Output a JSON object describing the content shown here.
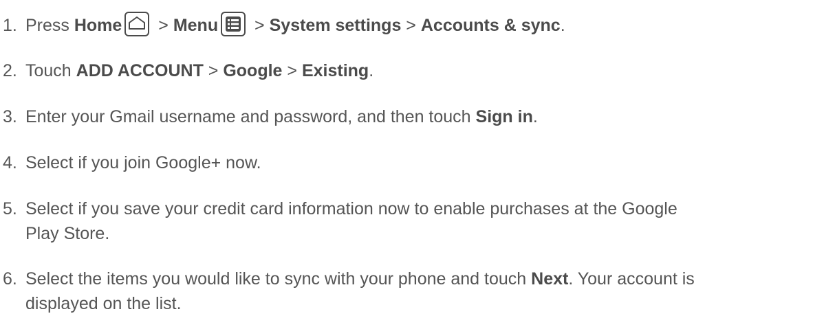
{
  "steps": [
    {
      "num": "1.",
      "parts": {
        "press": "Press ",
        "home": "Home",
        "sep1": " > ",
        "menu": "Menu",
        "sep2": " > ",
        "system_settings": "System settings",
        "sep3": " > ",
        "accounts_sync": "Accounts & sync",
        "end": "."
      }
    },
    {
      "num": "2.",
      "parts": {
        "touch": "Touch ",
        "add_account": "ADD ACCOUNT",
        "sep1": " > ",
        "google": "Google",
        "sep2": " > ",
        "existing": "Existing",
        "end": "."
      }
    },
    {
      "num": "3.",
      "parts": {
        "text": "Enter your Gmail username and password, and then touch ",
        "sign_in": "Sign in",
        "end": "."
      }
    },
    {
      "num": "4.",
      "parts": {
        "text": "Select if you join Google+ now."
      }
    },
    {
      "num": "5.",
      "parts": {
        "line1": "Select if you save your credit card information now to enable purchases at the Google",
        "line2": "Play Store."
      }
    },
    {
      "num": "6.",
      "parts": {
        "text1": "Select the items you would like to sync with your phone and touch ",
        "next": "Next",
        "text2": ". Your account is",
        "line2": "displayed on the list."
      }
    }
  ],
  "icons": {
    "home": "home-key-icon",
    "menu": "menu-key-icon"
  }
}
